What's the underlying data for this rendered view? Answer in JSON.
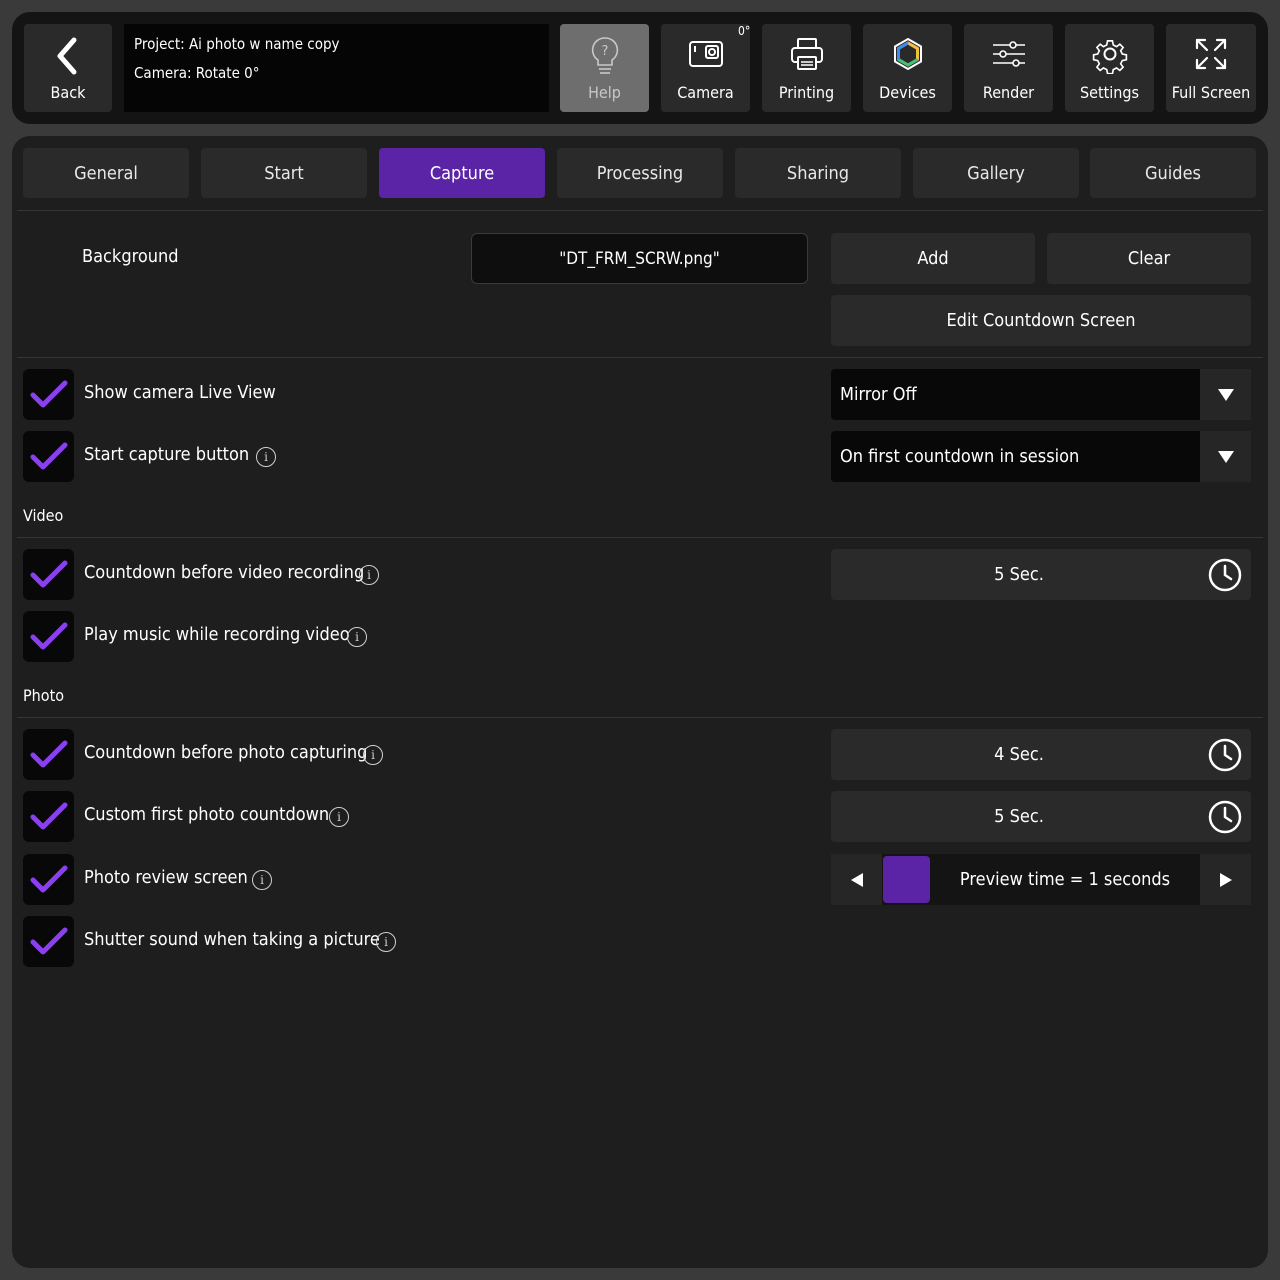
{
  "topbar": {
    "back_label": "Back",
    "project_line": "Project: Ai photo w name copy",
    "camera_line": "Camera: Rotate 0°",
    "rotation_badge": "0°",
    "buttons": [
      {
        "label": "Help",
        "icon": "lightbulb-question-icon"
      },
      {
        "label": "Camera",
        "icon": "camera-icon"
      },
      {
        "label": "Printing",
        "icon": "printer-icon"
      },
      {
        "label": "Devices",
        "icon": "devices-hexagon-icon"
      },
      {
        "label": "Render",
        "icon": "sliders-icon"
      },
      {
        "label": "Settings",
        "icon": "gear-icon"
      },
      {
        "label": "Full Screen",
        "icon": "fullscreen-arrows-icon"
      }
    ]
  },
  "tabs": [
    "General",
    "Start",
    "Capture",
    "Processing",
    "Sharing",
    "Gallery",
    "Guides"
  ],
  "active_tab": "Capture",
  "background": {
    "label": "Background",
    "file_value": "\"DT_FRM_SCRW.png\"",
    "add_label": "Add",
    "clear_label": "Clear",
    "edit_countdown_label": "Edit Countdown Screen"
  },
  "options": {
    "live_view": {
      "label": "Show camera Live View",
      "checked": true,
      "dropdown": "Mirror Off"
    },
    "start_capture": {
      "label": "Start capture button",
      "checked": true,
      "dropdown": "On first countdown in session"
    }
  },
  "video": {
    "section_label": "Video",
    "countdown": {
      "label": "Countdown before video recording",
      "checked": true,
      "value": "5  Sec."
    },
    "music": {
      "label": "Play music while recording video",
      "checked": true
    }
  },
  "photo": {
    "section_label": "Photo",
    "countdown": {
      "label": "Countdown before photo capturing",
      "checked": true,
      "value": "4  Sec."
    },
    "first_countdown": {
      "label": "Custom first photo countdown",
      "checked": true,
      "value": "5  Sec."
    },
    "review": {
      "label": "Photo review screen",
      "checked": true,
      "value": "Preview time = 1 seconds"
    },
    "shutter": {
      "label": "Shutter sound when taking a picture",
      "checked": true
    }
  },
  "colors": {
    "accent": "#5b24a6",
    "check": "#8a3ff0",
    "panel": "#1e1e1e",
    "button": "#2a2a2a"
  }
}
